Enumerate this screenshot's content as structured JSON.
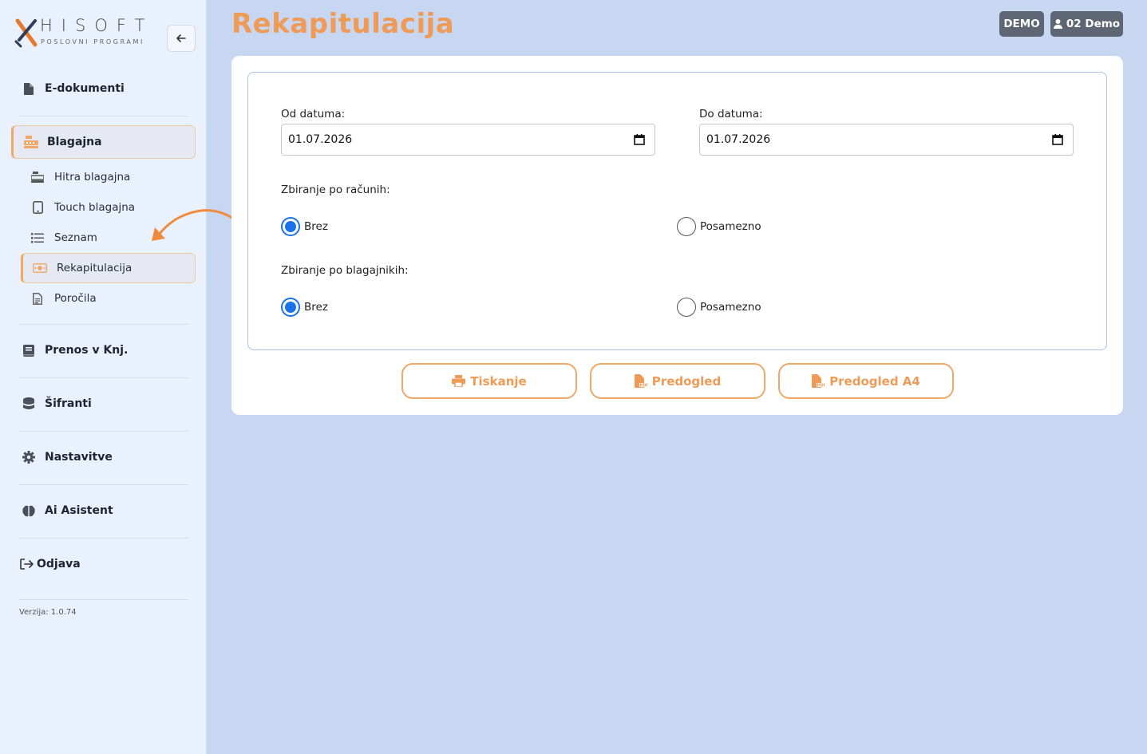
{
  "app": {
    "logo_text": "HISOFT",
    "logo_sub": "POSLOVNI PROGRAMI"
  },
  "sidebar": {
    "items": [
      {
        "label": "E-dokumenti",
        "icon": "file-icon"
      },
      {
        "label": "Blagajna",
        "icon": "cash-register-icon"
      },
      {
        "label": "Prenos v Knj.",
        "icon": "book-icon"
      },
      {
        "label": "Šifranti",
        "icon": "database-icon"
      },
      {
        "label": "Nastavitve",
        "icon": "gear-icon"
      },
      {
        "label": "Ai Asistent",
        "icon": "brain-icon"
      },
      {
        "label": "Odjava",
        "icon": "logout-icon"
      }
    ],
    "sub_items": [
      {
        "label": "Hitra blagajna",
        "icon": "cash-register-icon"
      },
      {
        "label": "Touch blagajna",
        "icon": "tablet-icon"
      },
      {
        "label": "Seznam",
        "icon": "list-icon"
      },
      {
        "label": "Rekapitulacija",
        "icon": "money-icon"
      },
      {
        "label": "Poročila",
        "icon": "report-icon"
      }
    ],
    "version": "Verzija: 1.0.74"
  },
  "header": {
    "title": "Rekapitulacija",
    "badge_demo": "DEMO",
    "user_label": "02 Demo"
  },
  "form": {
    "from_label": "Od datuma:",
    "from_value": "01.07.2026",
    "to_label": "Do datuma:",
    "to_value": "01.07.2026",
    "group1_label": "Zbiranje po računih:",
    "group2_label": "Zbiranje po blagajnikih:",
    "option_brez": "Brez",
    "option_posamezno": "Posamezno",
    "group1_selected": "Brez",
    "group2_selected": "Brez"
  },
  "actions": {
    "print_label": "Tiskanje",
    "preview_label": "Predogled",
    "preview_a4_label": "Predogled A4"
  },
  "colors": {
    "accent": "#ef9b57",
    "radio_checked": "#1a73e8",
    "sidebar_bg": "#e9f1fc",
    "page_bg": "#c8d7f1"
  }
}
